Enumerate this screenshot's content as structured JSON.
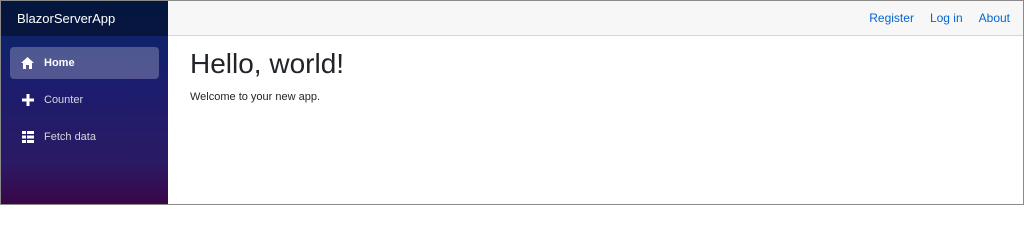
{
  "brand": {
    "title": "BlazorServerApp"
  },
  "sidebar": {
    "items": [
      {
        "label": "Home",
        "icon": "home-icon",
        "active": true
      },
      {
        "label": "Counter",
        "icon": "plus-icon",
        "active": false
      },
      {
        "label": "Fetch data",
        "icon": "list-icon",
        "active": false
      }
    ]
  },
  "top_nav": {
    "links": [
      {
        "label": "Register"
      },
      {
        "label": "Log in"
      },
      {
        "label": "About"
      }
    ]
  },
  "main": {
    "title": "Hello, world!",
    "text": "Welcome to your new app."
  },
  "colors": {
    "sidebar_top": "#052767",
    "sidebar_bottom": "#3a0647",
    "link": "#0366d6",
    "top_row_bg": "#f7f7f7"
  }
}
